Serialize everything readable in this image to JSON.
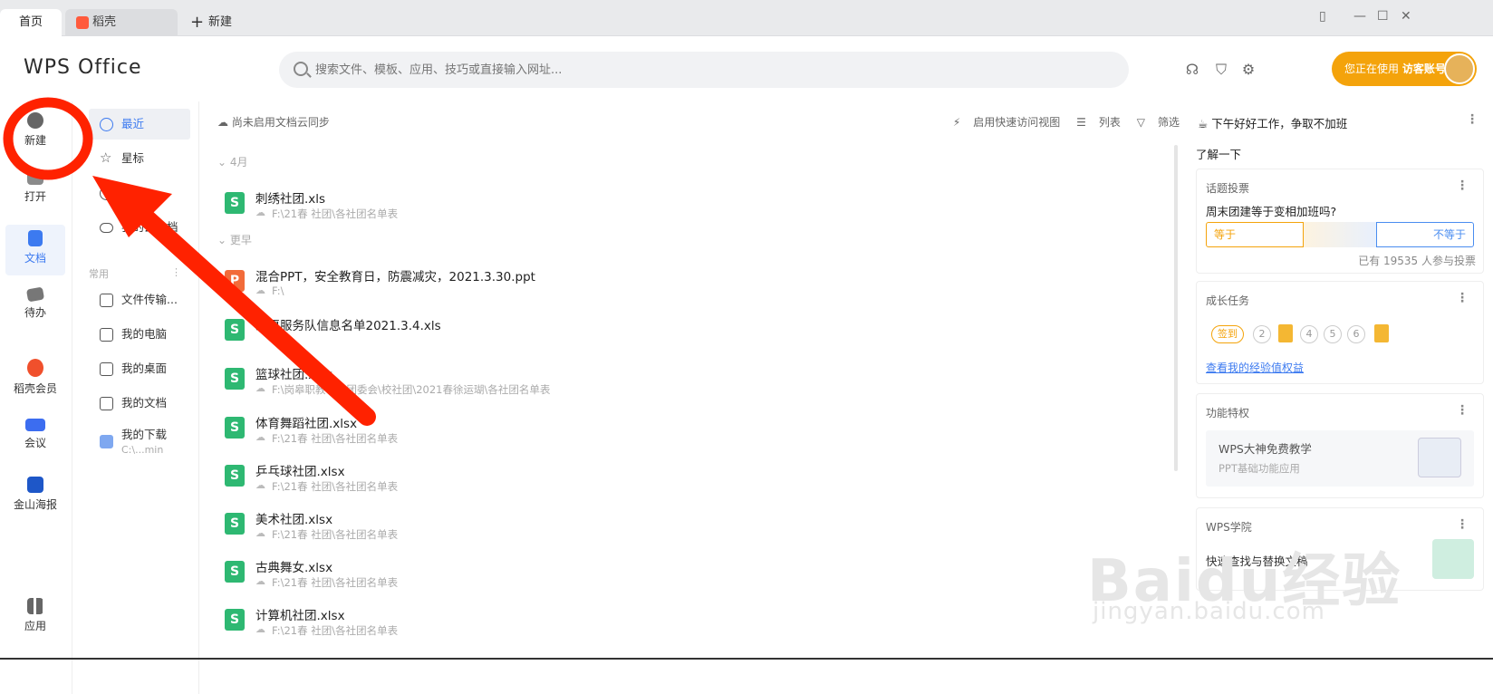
{
  "tabs": {
    "home": "首页",
    "daoke": "稻壳",
    "new": "新建"
  },
  "header": {
    "logo": "WPS Office",
    "search_placeholder": "搜索文件、模板、应用、技巧或直接输入网址...",
    "account_prefix": "您正在使用",
    "account_name": "访客账号"
  },
  "leftnav": [
    {
      "label": "新建",
      "icon": "plus-circle-icon"
    },
    {
      "label": "打开",
      "icon": "folder-open-icon"
    },
    {
      "label": "文档",
      "icon": "document-icon"
    },
    {
      "label": "待办",
      "icon": "check-icon"
    },
    {
      "label": "稻壳会员",
      "icon": "daoke-icon"
    },
    {
      "label": "会议",
      "icon": "video-icon"
    },
    {
      "label": "金山海报",
      "icon": "poster-icon"
    },
    {
      "label": "应用",
      "icon": "apps-icon"
    }
  ],
  "subnav": {
    "items": [
      "最近",
      "星标",
      "共享",
      "我的云文档"
    ],
    "group_label": "常用",
    "common": [
      "文件传输...",
      "我的电脑",
      "我的桌面",
      "我的文档",
      "我的下载"
    ],
    "download_path": "C:\\...min"
  },
  "main": {
    "sync_text": "尚未启用文档云同步",
    "tools": [
      "启用快速访问视图",
      "列表",
      "筛选"
    ],
    "groups": [
      "4月",
      "更早"
    ],
    "files": [
      {
        "name": "刺绣社团.xls",
        "path": "F:\\21春 社团\\各社团名单表",
        "type": "S",
        "color": "#2eb872"
      },
      {
        "name": "混合PPT，安全教育日，防震减灾，2021.3.30.ppt",
        "path": "F:\\",
        "type": "P",
        "color": "#f26b3a"
      },
      {
        "name": "志愿服务队信息名单2021.3.4.xls",
        "path": "",
        "type": "S",
        "color": "#2eb872"
      },
      {
        "name": "篮球社团.xlsx",
        "path": "F:\\岗皋职教中心团委会\\校社团\\2021春徐运瑚\\各社团名单表",
        "type": "S",
        "color": "#2eb872"
      },
      {
        "name": "体育舞蹈社团.xlsx",
        "path": "F:\\21春 社团\\各社团名单表",
        "type": "S",
        "color": "#2eb872"
      },
      {
        "name": "乒乓球社团.xlsx",
        "path": "F:\\21春 社团\\各社团名单表",
        "type": "S",
        "color": "#2eb872"
      },
      {
        "name": "美术社团.xlsx",
        "path": "F:\\21春 社团\\各社团名单表",
        "type": "S",
        "color": "#2eb872"
      },
      {
        "name": "古典舞女.xlsx",
        "path": "F:\\21春 社团\\各社团名单表",
        "type": "S",
        "color": "#2eb872"
      },
      {
        "name": "计算机社团.xlsx",
        "path": "F:\\21春 社团\\各社团名单表",
        "type": "S",
        "color": "#2eb872"
      }
    ]
  },
  "right": {
    "greeting": "下午好好工作，争取不加班",
    "understand": "了解一下",
    "vote": {
      "title": "话题投票",
      "question": "周末团建等于变相加班吗?",
      "yes": "等于",
      "no": "不等于",
      "count": "已有 19535 人参与投票"
    },
    "growth": {
      "title": "成长任务",
      "signin": "签到",
      "steps": [
        "2",
        "4",
        "5",
        "6"
      ],
      "link": "查看我的经验值权益"
    },
    "feature": {
      "title": "功能特权",
      "t1": "WPS大神免费教学",
      "t2": "PPT基础功能应用"
    },
    "academy": {
      "title": "WPS学院",
      "text": "快速查找与替换文稿"
    }
  },
  "watermark": {
    "line1": "Baidu经验",
    "line2": "jingyan.baidu.com"
  },
  "colors": {
    "accent": "#3c7af0",
    "account": "#f4a30b",
    "annotation": "#ff2200"
  }
}
